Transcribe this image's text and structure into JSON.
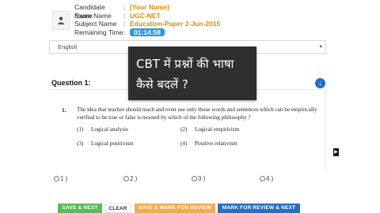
{
  "candidate": {
    "rows": [
      {
        "label": "Candidate Name",
        "value": "[Your Name]"
      },
      {
        "label": "Exam Name",
        "value": "UGC-NET"
      },
      {
        "label": "Subject Name",
        "value": "Education-Paper 2-Jun-2015"
      }
    ],
    "remaining_label": "Remaining Time",
    "remaining_value": "01:14:58",
    "avatar_icon": "user-icon"
  },
  "language": {
    "selected": "English"
  },
  "banner": {
    "line1": "CBT में प्रश्नों की भाषा",
    "line2": "कैसे बदलें ?"
  },
  "question": {
    "title": "Question 1:",
    "number": "1.",
    "text": "The idea that teacher should teach and even use only those words and sentences which can be empirically verified to be true or false is mooted by which of the following philosophy ?",
    "options": [
      {
        "num": "(1)",
        "text": "Logical analysis"
      },
      {
        "num": "(2)",
        "text": "Logical empiricism"
      },
      {
        "num": "(3)",
        "text": "Logical positivism"
      },
      {
        "num": "(4)",
        "text": "Positive relativism"
      }
    ]
  },
  "answers": [
    "1 )",
    "2 )",
    "3 )",
    "4 )"
  ],
  "buttons": {
    "save_next": "SAVE & NEXT",
    "clear": "CLEAR",
    "save_mark": "SAVE & MARK FOR REVIEW",
    "mark_next": "MARK FOR REVIEW & NEXT"
  },
  "colors": {
    "accent_orange": "#e08a00",
    "timer_blue": "#2c9ad8",
    "save_green": "#5cb85c",
    "review_orange": "#f0ad4e",
    "review_blue": "#2a6ebd"
  }
}
